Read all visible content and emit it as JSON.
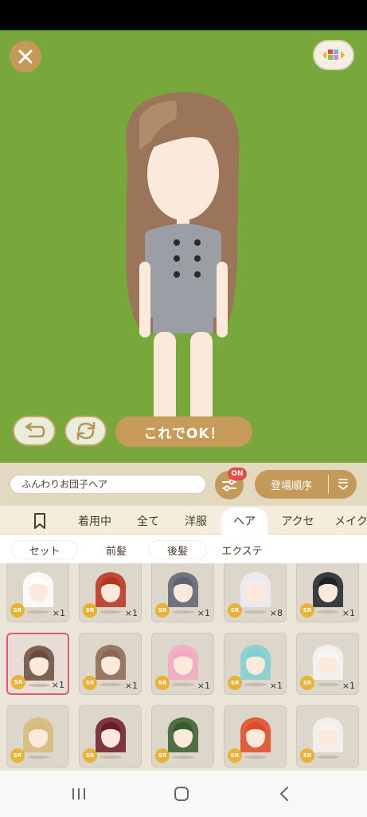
{
  "colors": {
    "stage": "#78a83c",
    "accent": "#c49a5b",
    "badge": "#e64a4a",
    "rarity": "#e8b237",
    "selected": "#e0577a"
  },
  "controls": {
    "ok_label": "これでOK！"
  },
  "search": {
    "value": "ふんわりお団子ヘア"
  },
  "filter": {
    "badge": "ON"
  },
  "sort": {
    "label": "登場順序"
  },
  "tabs": [
    {
      "icon": "bookmark-icon"
    },
    {
      "label": "着用中"
    },
    {
      "label": "全て"
    },
    {
      "label": "洋服"
    },
    {
      "label": "ヘア",
      "active": true
    },
    {
      "label": "アクセ"
    },
    {
      "label": "メイク"
    }
  ],
  "subtabs": [
    {
      "label": "セット"
    },
    {
      "label": "前髪"
    },
    {
      "label": "後髪"
    },
    {
      "label": "エクステ"
    }
  ],
  "items": [
    {
      "rarity": "SR",
      "qty": "×1",
      "hair": "#ffffff",
      "bangs": "pink-accent"
    },
    {
      "rarity": "SR",
      "qty": "×1",
      "hair": "#b8321f"
    },
    {
      "rarity": "SR",
      "qty": "×1",
      "hair": "#5d6470"
    },
    {
      "rarity": "SR",
      "qty": "×8",
      "hair": "#f1ecf6"
    },
    {
      "rarity": "SR",
      "qty": "×1",
      "hair": "#1b2228"
    },
    {
      "rarity": "SR",
      "qty": "×1",
      "hair": "#6a4c3a",
      "selected": true
    },
    {
      "rarity": "SR",
      "qty": "×1",
      "hair": "#8c6654"
    },
    {
      "rarity": "SR",
      "qty": "×1",
      "hair": "#f3a9c3"
    },
    {
      "rarity": "SR",
      "qty": "×1",
      "hair": "#7fd0d2"
    },
    {
      "rarity": "SR",
      "qty": "×1",
      "hair": "#f6f6f4"
    },
    {
      "rarity": "SR",
      "qty": "",
      "hair": "#d8bb7a"
    },
    {
      "rarity": "SR",
      "qty": "",
      "hair": "#6d1a2a"
    },
    {
      "rarity": "SR",
      "qty": "",
      "hair": "#3a5c2c"
    },
    {
      "rarity": "SR",
      "qty": "",
      "hair": "#e04a26"
    },
    {
      "rarity": "SR",
      "qty": "",
      "hair": "#f5f3ee"
    }
  ],
  "nav": [
    {
      "icon": "recents-icon"
    },
    {
      "icon": "home-icon"
    },
    {
      "icon": "back-icon"
    }
  ]
}
